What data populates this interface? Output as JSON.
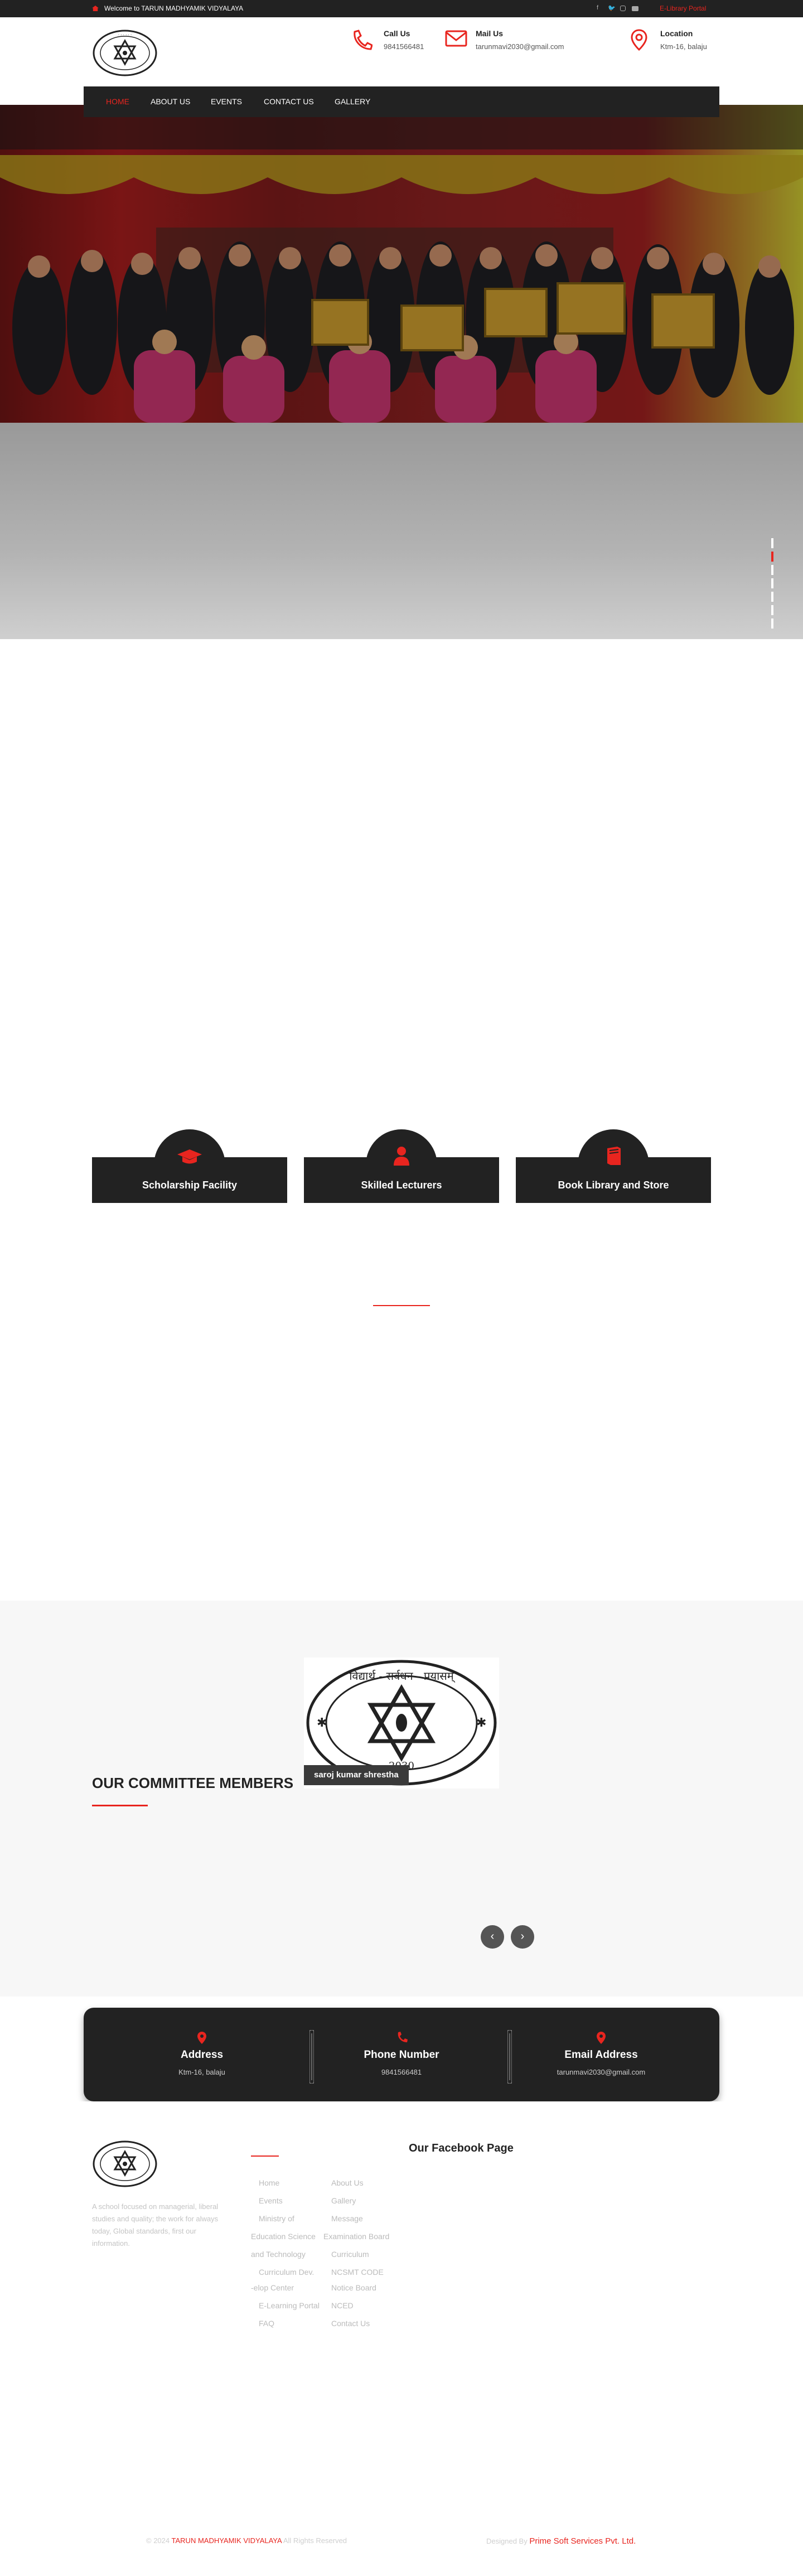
{
  "colors": {
    "accent": "#e8251f",
    "dark": "#222222",
    "light": "#f7f7f7"
  },
  "topbar": {
    "welcome": "Welcome to TARUN MADHYAMIK VIDYALAYA",
    "elibrary": "E-Library Portal",
    "social": [
      "facebook-icon",
      "twitter-icon",
      "instagram-icon",
      "youtube-icon"
    ]
  },
  "header": {
    "call": {
      "title": "Call Us",
      "value": "9841566481"
    },
    "mail": {
      "title": "Mail Us",
      "value": "tarunmavi2030@gmail.com"
    },
    "location": {
      "title": "Location",
      "value": "Ktm-16, balaju"
    }
  },
  "nav": {
    "items": [
      "Home",
      "About Us",
      "Events",
      "Contact Us",
      "Gallery"
    ],
    "active": "Home"
  },
  "hero": {
    "slide_count": 7,
    "active_slide": 1
  },
  "features": [
    {
      "title": "Scholarship Facility",
      "icon": "graduation-cap-icon"
    },
    {
      "title": "Skilled Lecturers",
      "icon": "user-icon"
    },
    {
      "title": "Book Library and Store",
      "icon": "book-icon"
    }
  ],
  "committee": {
    "title": "OUR COMMITTEE MEMBERS",
    "member_name": "saroj kumar shrestha"
  },
  "contact": [
    {
      "title": "Address",
      "value": "Ktm-16, balaju",
      "icon": "map-marker-icon"
    },
    {
      "title": "Phone Number",
      "value": "9841566481",
      "icon": "phone-icon"
    },
    {
      "title": "Email Address",
      "value": "tarunmavi2030@gmail.com",
      "icon": "map-marker-icon"
    }
  ],
  "footer": {
    "about": "A school focused on managerial, liberal studies and quality; the work for always today, Global standards, first our information.",
    "facebook_title": "Our Facebook Page",
    "links_col1": [
      "Home",
      "Events",
      "Ministry of",
      "Education Science",
      "and Technology",
      "Curriculum Dev.",
      "-elop Center",
      "E-Learning Portal",
      "FAQ"
    ],
    "links_col2": [
      "About Us",
      "Gallery",
      "Message",
      "Examination Board",
      "Curriculum",
      "NCSMT CODE",
      "Notice Board",
      "NCED",
      "Contact Us"
    ],
    "copyright_prefix": "© 2024",
    "copyright_name": "TARUN MADHYAMIK VIDYALAYA",
    "copyright_suffix": "All Rights Reserved",
    "designed_prefix": "Designed By",
    "designed_by": "Prime Soft Services Pvt. Ltd."
  }
}
